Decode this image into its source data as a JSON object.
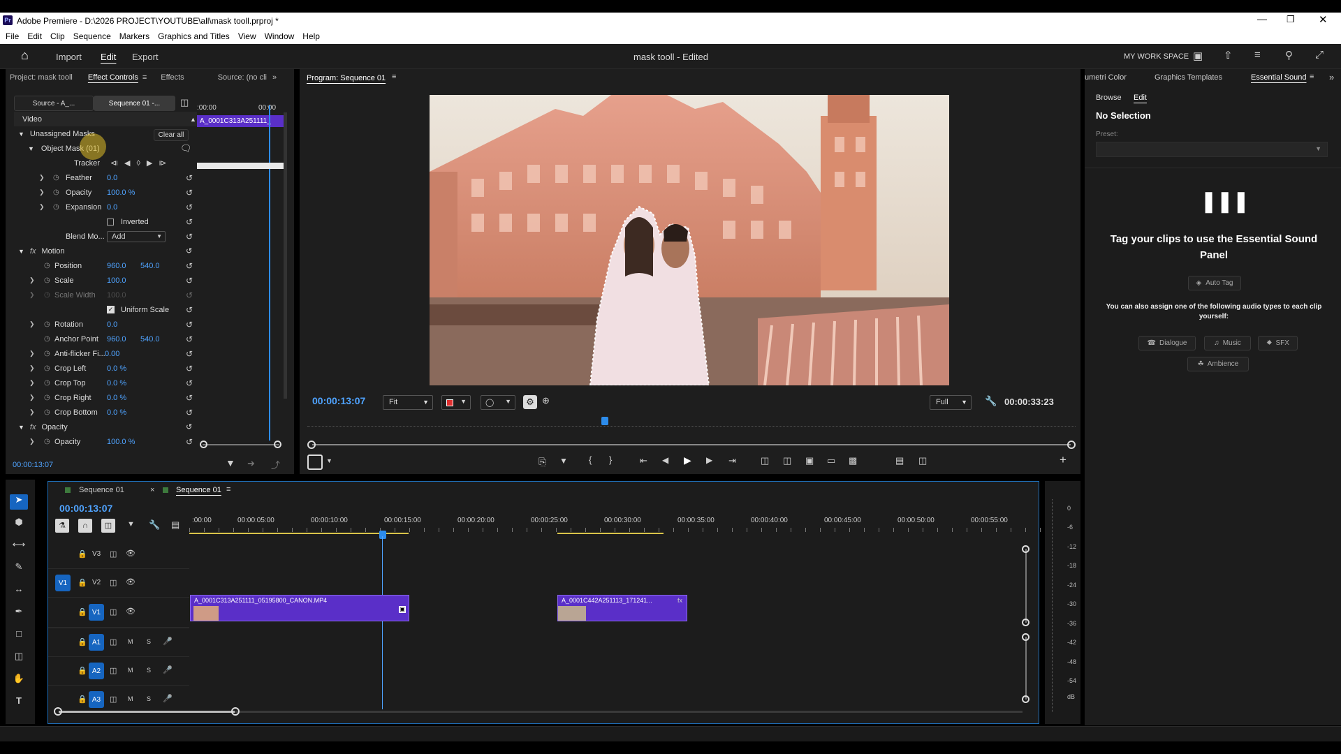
{
  "titlebar": {
    "title": "Adobe Premiere - D:\\2026 PROJECT\\YOUTUBE\\all\\mask tooll.prproj *"
  },
  "menu": [
    "File",
    "Edit",
    "Clip",
    "Sequence",
    "Markers",
    "Graphics and Titles",
    "View",
    "Window",
    "Help"
  ],
  "header": {
    "tabs": [
      "Import",
      "Edit",
      "Export"
    ],
    "doc_title": "mask tooll - Edited",
    "workspace": "MY WORK SPACE"
  },
  "left_tabs": [
    "Project: mask tooll",
    "Effect Controls",
    "Effects",
    "Source: (no cli"
  ],
  "ec": {
    "source_btn": "Source - A_...",
    "sequence_btn": "Sequence 01 -...",
    "mini_time": ":00:00",
    "mini_time2": "00:00",
    "clip_label": "A_0001C313A251111_",
    "video_label": "Video",
    "unassigned": "Unassigned Masks",
    "clear_all": "Clear all",
    "object_mask": "Object Mask (01)",
    "tracker": "Tracker",
    "feather": {
      "label": "Feather",
      "v": "0.0"
    },
    "opacity_m": {
      "label": "Opacity",
      "v": "100.0 %"
    },
    "expansion": {
      "label": "Expansion",
      "v": "0.0"
    },
    "inverted": "Inverted",
    "blend": {
      "label": "Blend Mo...",
      "v": "Add"
    },
    "motion": "Motion",
    "position": {
      "label": "Position",
      "v1": "960.0",
      "v2": "540.0"
    },
    "scale": {
      "label": "Scale",
      "v": "100.0"
    },
    "scale_width": {
      "label": "Scale Width",
      "v": "100.0"
    },
    "uniform": "Uniform Scale",
    "rotation": {
      "label": "Rotation",
      "v": "0.0"
    },
    "anchor": {
      "label": "Anchor Point",
      "v1": "960.0",
      "v2": "540.0"
    },
    "antiflicker": {
      "label": "Anti-flicker Fi...",
      "v": "0.00"
    },
    "crop_left": {
      "label": "Crop Left",
      "v": "0.0 %"
    },
    "crop_top": {
      "label": "Crop Top",
      "v": "0.0 %"
    },
    "crop_right": {
      "label": "Crop Right",
      "v": "0.0 %"
    },
    "crop_bottom": {
      "label": "Crop Bottom",
      "v": "0.0 %"
    },
    "opacity_sec": "Opacity",
    "opacity": {
      "label": "Opacity",
      "v": "100.0 %"
    },
    "timecode": "00:00:13:07"
  },
  "program": {
    "title": "Program: Sequence 01",
    "timecode": "00:00:13:07",
    "fit": "Fit",
    "quality": "Full",
    "duration": "00:00:33:23"
  },
  "right": {
    "tabs": [
      "umetri Color",
      "Graphics Templates",
      "Essential Sound"
    ],
    "subtabs": [
      "Browse",
      "Edit"
    ],
    "no_selection": "No Selection",
    "preset": "Preset:",
    "heading": "Tag your clips to use the Essential Sound Panel",
    "auto_tag": "Auto Tag",
    "hint": "You can also assign one of the following audio types to each clip yourself:",
    "types": [
      "Dialogue",
      "Music",
      "SFX",
      "Ambience"
    ]
  },
  "timeline": {
    "tabs": [
      "Sequence 01",
      "Sequence 01"
    ],
    "timecode": "00:00:13:07",
    "ruler": [
      ":00:00",
      "00:00:05:00",
      "00:00:10:00",
      "00:00:15:00",
      "00:00:20:00",
      "00:00:25:00",
      "00:00:30:00",
      "00:00:35:00",
      "00:00:40:00",
      "00:00:45:00",
      "00:00:50:00",
      "00:00:55:00"
    ],
    "tracks": [
      "V3",
      "V2",
      "V1",
      "A1",
      "A2",
      "A3"
    ],
    "src_patch": "V1",
    "track_btns": {
      "m": "M",
      "s": "S"
    },
    "clip1": "A_0001C313A251111_05195800_CANON.MP4",
    "clip2": "A_0001C442A251113_171241...",
    "meter": [
      "0",
      "-6",
      "-12",
      "-18",
      "-24",
      "-30",
      "-36",
      "-42",
      "-48",
      "-54",
      "dB"
    ]
  },
  "colors": {
    "accent": "#2d8ceb",
    "clip": "#5a2fc8",
    "track_active": "#1665c0"
  }
}
